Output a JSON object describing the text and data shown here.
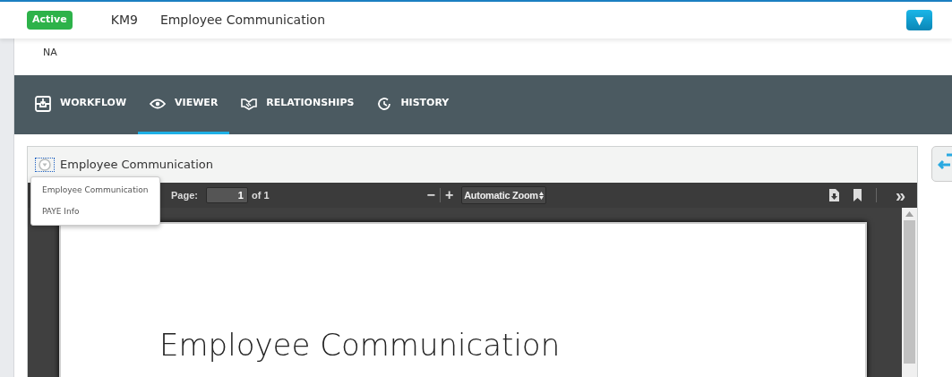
{
  "header": {
    "status": "Active",
    "code": "KM9",
    "title": "Employee Communication",
    "menu_button": "▼"
  },
  "summary": "NA",
  "tabs": [
    {
      "label": "WORKFLOW",
      "kind": "workflow",
      "selected": false
    },
    {
      "label": "VIEWER",
      "kind": "viewer",
      "selected": true
    },
    {
      "label": "RELATIONSHIPS",
      "kind": "relationships",
      "selected": false
    },
    {
      "label": "HISTORY",
      "kind": "history",
      "selected": false
    }
  ],
  "document_panel": {
    "title": "Employee Communication",
    "dropdown": {
      "expanded": true,
      "items": [
        {
          "label": "Employee Communication"
        },
        {
          "label": "PAYE Info"
        }
      ]
    },
    "pdf_toolbar": {
      "page_label": "Page:",
      "page_value": "1",
      "page_of": "of 1",
      "zoom_out": "−",
      "zoom_in": "+",
      "zoom": "Automatic Zoom",
      "more": "»"
    },
    "page_heading": "Employee Communication"
  }
}
